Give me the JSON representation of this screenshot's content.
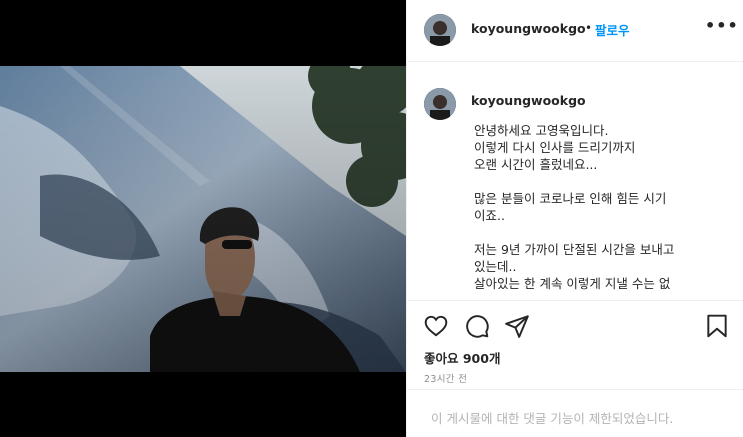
{
  "post": {
    "username": "koyoungwookgo",
    "separator": "•",
    "follow_label": "팔로우",
    "more_icon": "more-options-icon"
  },
  "caption": {
    "username": "koyoungwookgo",
    "paragraphs": [
      [
        "안녕하세요 고영욱입니다.",
        "이렇게 다시 인사를 드리기까지",
        "오랜 시간이 흘렀네요..."
      ],
      [
        "많은 분들이 코로나로 인해 힘든 시기",
        "이죠.."
      ],
      [
        "저는 9년 가까이 단절된 시간을 보내고",
        "있는데..",
        "살아있는 한 계속 이렇게 지낼 수는 없"
      ]
    ]
  },
  "actions": {
    "icons": [
      "heart-icon",
      "comment-icon",
      "share-icon",
      "bookmark-icon"
    ],
    "likes_label": "좋아요 900개",
    "timestamp": "23시간 전"
  },
  "comments": {
    "disabled_text": "이 게시물에 대한 댓글 기능이 제한되었습니다."
  },
  "colors": {
    "accent": "#0095f6",
    "text": "#262626",
    "muted": "#8e8e8e"
  }
}
